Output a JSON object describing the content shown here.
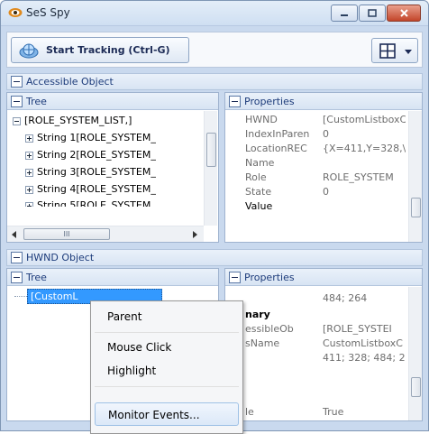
{
  "window": {
    "title": "SeS Spy",
    "controls": [
      "minimize-icon",
      "maximize-icon",
      "close-icon"
    ]
  },
  "toolbar": {
    "start_tracking_label": "Start Tracking (Ctrl-G)",
    "start_icon": "tracking-icon",
    "layout_icon": "grid-layout-icon"
  },
  "accessible_section": {
    "title": "Accessible Object",
    "tree_title": "Tree",
    "tree_items": [
      {
        "label": "[ROLE_SYSTEM_LIST,]",
        "expander": "minus"
      },
      {
        "label": "String 1[ROLE_SYSTEM_",
        "expander": "plus"
      },
      {
        "label": "String 2[ROLE_SYSTEM_",
        "expander": "plus"
      },
      {
        "label": "String 3[ROLE_SYSTEM_",
        "expander": "plus"
      },
      {
        "label": "String 4[ROLE_SYSTEM_",
        "expander": "plus"
      },
      {
        "label": "String 5[ROLE_SYSTEM_",
        "expander": "plus"
      }
    ],
    "properties_title": "Properties",
    "properties": [
      {
        "name": "HWND",
        "value": "[CustomListboxC"
      },
      {
        "name": "IndexInParen",
        "value": "0"
      },
      {
        "name": "LocationREC",
        "value": "{X=411,Y=328,\\"
      },
      {
        "name": "Name",
        "value": ""
      },
      {
        "name": "Role",
        "value": "ROLE_SYSTEM"
      },
      {
        "name": "State",
        "value": "0"
      },
      {
        "name": "Value",
        "value": ""
      }
    ],
    "hscroll_thumb_text": "III"
  },
  "hwnd_section": {
    "title": "HWND Object",
    "tree_title": "Tree",
    "tree_items": [
      {
        "label": "[CustomL"
      }
    ],
    "properties_title": "Properties",
    "properties": [
      {
        "name": "",
        "value": "484; 264"
      },
      {
        "name": "nary",
        "value": ""
      },
      {
        "name": "essibleOb",
        "value": "[ROLE_SYSTEI"
      },
      {
        "name": "sName",
        "value": "CustomListboxC"
      },
      {
        "name": "",
        "value": "411; 328; 484; 2"
      },
      {
        "name": "",
        "value": ""
      },
      {
        "name": "le",
        "value": "True"
      }
    ]
  },
  "context_menu": {
    "items": [
      "Parent",
      "Mouse Click",
      "Highlight",
      "Monitor Events..."
    ],
    "highlighted": "Monitor Events..."
  },
  "colors": {
    "accent": "#1c3b7a",
    "frame": "#c9d9ee",
    "header": "#d8e4f3"
  }
}
